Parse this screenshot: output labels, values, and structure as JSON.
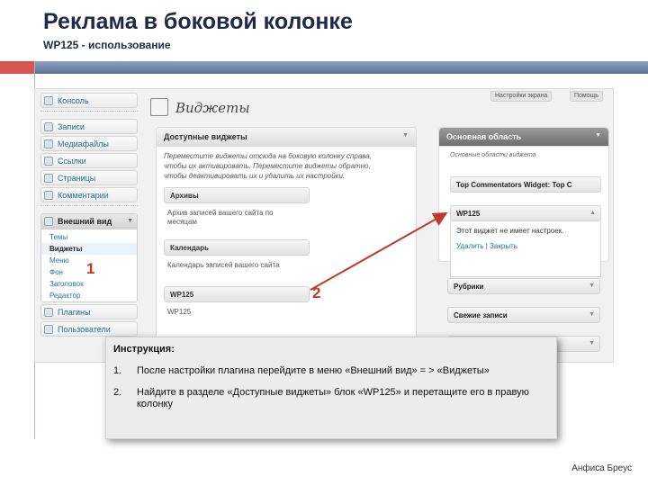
{
  "slide": {
    "title": "Реклама в боковой колонке",
    "subtitle": "WP125 - использование",
    "author": "Анфиса Бреус",
    "accent_color": "#d9534f"
  },
  "admin_sidebar": {
    "items_top": [
      {
        "label": "Консоль",
        "icon": "dashboard-icon"
      }
    ],
    "items_mid": [
      {
        "label": "Записи",
        "icon": "posts-icon"
      },
      {
        "label": "Медиафайлы",
        "icon": "media-icon"
      },
      {
        "label": "Ссылки",
        "icon": "links-icon"
      },
      {
        "label": "Страницы",
        "icon": "pages-icon"
      },
      {
        "label": "Комментарии",
        "icon": "comments-icon"
      }
    ],
    "appearance": {
      "label": "Внешний вид",
      "submenu": [
        "Темы",
        "Виджеты",
        "Меню",
        "Фон",
        "Заголовок",
        "Редактор"
      ],
      "active": "Виджеты"
    },
    "items_bottom": [
      {
        "label": "Плагины",
        "icon": "plugins-icon"
      },
      {
        "label": "Пользователи",
        "icon": "users-icon"
      }
    ]
  },
  "top_buttons": {
    "screen_options": "Настройки экрана",
    "help": "Помощь"
  },
  "page": {
    "title": "Виджеты"
  },
  "available_widgets": {
    "header": "Доступные виджеты",
    "description": "Переместите виджеты отсюда на боковую колонку справа, чтобы их активировать. Переместите виджеты обратно, чтобы деактивировать их и удалить их настройки.",
    "widgets": [
      {
        "name": "Архивы",
        "desc": "Архив записей вашего сайта по месяцам"
      },
      {
        "name": "Календарь",
        "desc": "Календарь записей вашего сайта"
      },
      {
        "name": "WP125",
        "desc": "WP125"
      }
    ]
  },
  "main_area": {
    "header": "Основная область",
    "description": "Основные области виджета",
    "widgets": [
      "Top Commentators Widget: Top C",
      "WP125"
    ],
    "wp125_panel": {
      "no_settings": "Этот виджет не имеет настроек.",
      "delete": "Удалить",
      "separator": "|",
      "close": "Закрыть"
    },
    "other_widgets": [
      "Рубрики",
      "Свежие записи",
      ""
    ]
  },
  "markers": {
    "one": "1",
    "two": "2"
  },
  "instructions": {
    "title": "Инструкция:",
    "steps": [
      {
        "num": "1.",
        "text": "После настройки плагина перейдите в меню «Внешний вид» = > «Виджеты»"
      },
      {
        "num": "2.",
        "text": "Найдите в разделе «Доступные виджеты» блок «WP125» и перетащите его в правую колонку"
      }
    ]
  }
}
